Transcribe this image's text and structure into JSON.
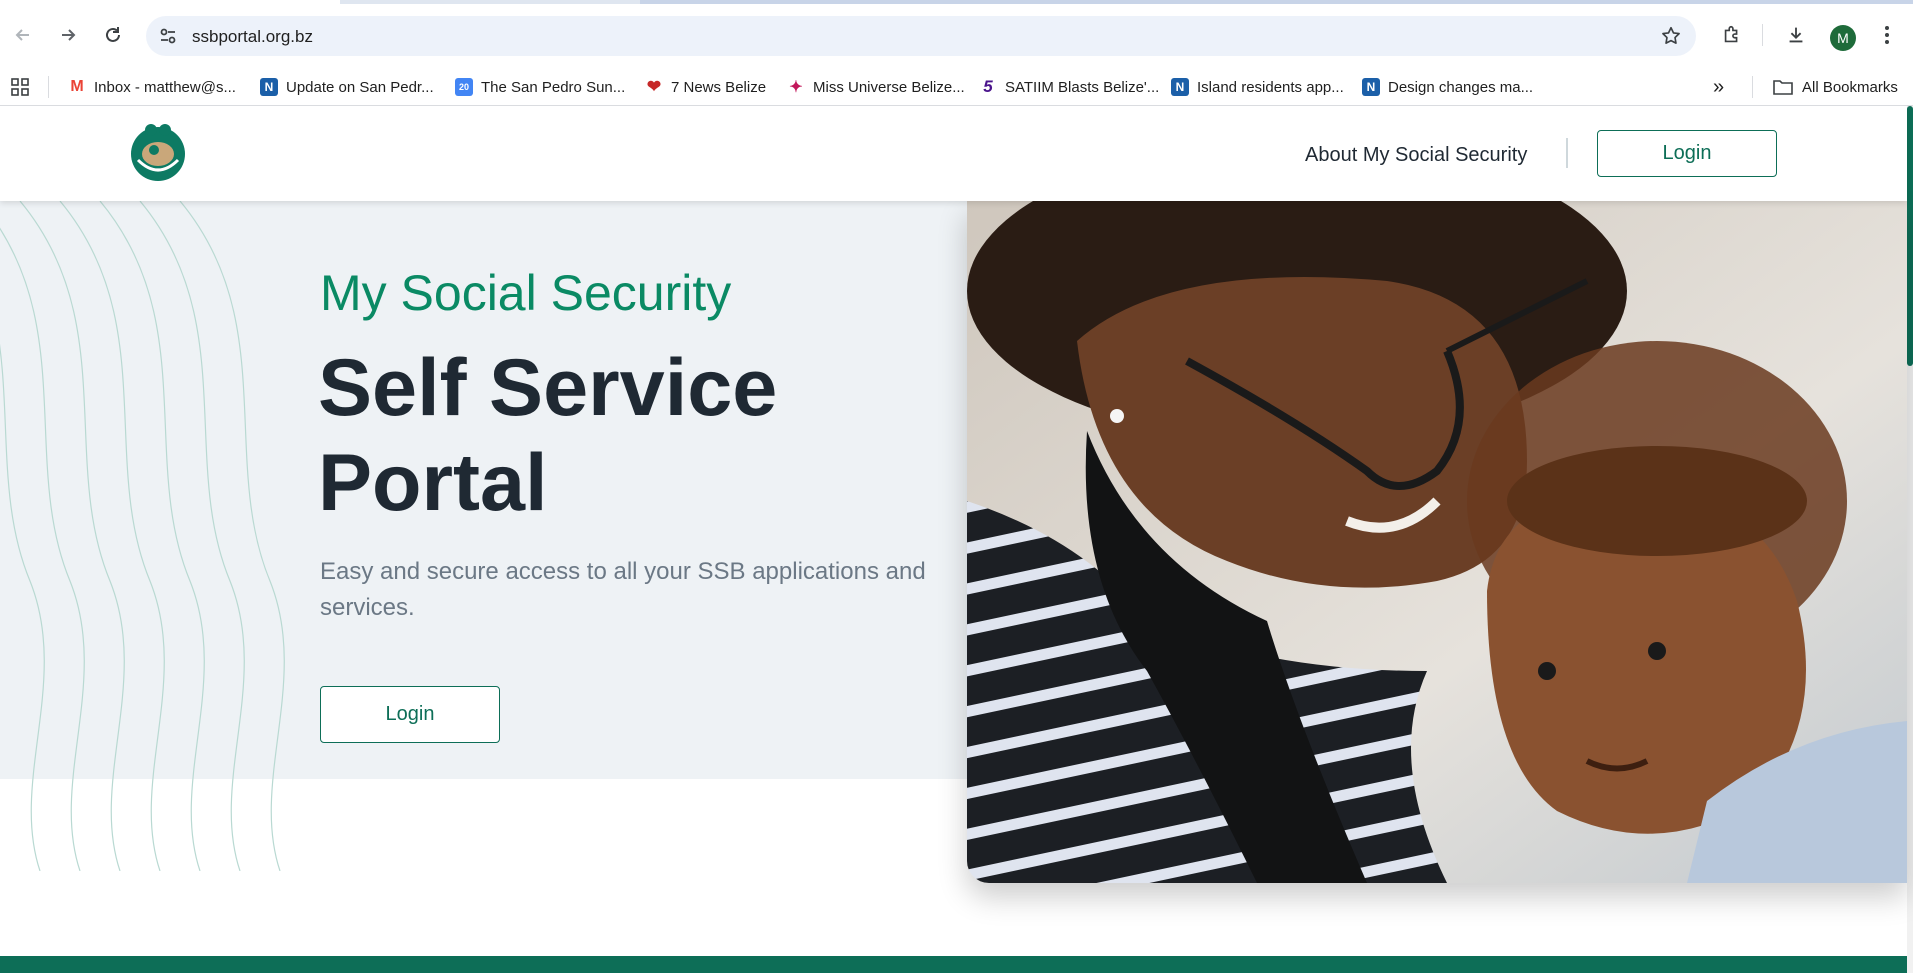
{
  "browser": {
    "url": "ssbportal.org.bz",
    "profile_initial": "M",
    "bookmarks": [
      {
        "label": "Inbox - matthew@s...",
        "icon": "gmail-icon",
        "color": "#ea4335"
      },
      {
        "label": "Update on San Pedr...",
        "icon": "n-icon",
        "color": "#1b5fa8"
      },
      {
        "label": "The San Pedro Sun...",
        "icon": "calendar-icon",
        "color": "#4285f4"
      },
      {
        "label": "7 News Belize",
        "icon": "heart-icon",
        "color": "#c62828"
      },
      {
        "label": "Miss Universe Belize...",
        "icon": "figure-icon",
        "color": "#c2185b"
      },
      {
        "label": "SATIIM Blasts Belize'...",
        "icon": "five-icon",
        "color": "#4a148c"
      },
      {
        "label": "Island residents app...",
        "icon": "n-icon",
        "color": "#1b5fa8"
      },
      {
        "label": "Design changes ma...",
        "icon": "n-icon",
        "color": "#1b5fa8"
      }
    ],
    "more_label": "»",
    "all_bookmarks_label": "All Bookmarks"
  },
  "site": {
    "nav_about": "About My Social Security",
    "nav_login": "Login",
    "brand_color": "#0d6e57"
  },
  "hero": {
    "eyebrow": "My Social Security",
    "headline": "Self Service Portal",
    "subtitle": "Easy and secure access to all your SSB applications and services.",
    "login_label": "Login"
  }
}
